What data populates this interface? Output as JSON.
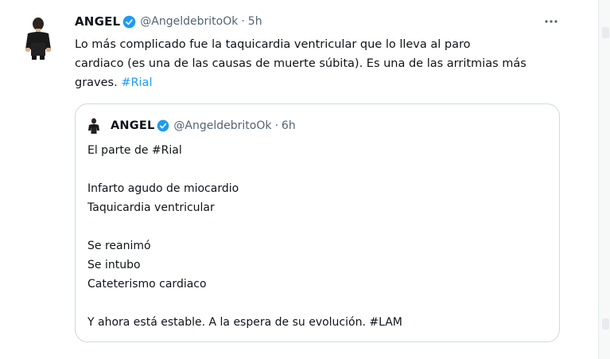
{
  "tweet": {
    "author_name": "ANGEL",
    "handle": "@AngeldebritoOk",
    "separator": "·",
    "time": "5h",
    "more_icon": "more-dots-icon",
    "text_lines": [
      "Lo más complicado fue la taquicardia ventricular que lo lleva al paro",
      "cardiaco (es una de las causas de muerte súbita). Es una de las arritmias más"
    ],
    "text_last_prefix": "graves. ",
    "hashtag": "#Rial"
  },
  "quoted": {
    "author_name": "ANGEL",
    "handle": "@AngeldebritoOk",
    "separator": "·",
    "time": "6h",
    "lines": [
      "El parte de #Rial",
      "",
      "Infarto agudo de miocardio",
      "Taquicardia ventricular",
      "",
      "Se reanimó",
      "Se intubo",
      "Cateterismo cardiaco",
      "",
      "Y ahora está estable. A la espera de su evolución.  #LAM"
    ]
  },
  "colors": {
    "link": "#1d9bf0",
    "verified": "#1d9bf0",
    "secondary_text": "#536471",
    "border": "#cfd9de"
  }
}
